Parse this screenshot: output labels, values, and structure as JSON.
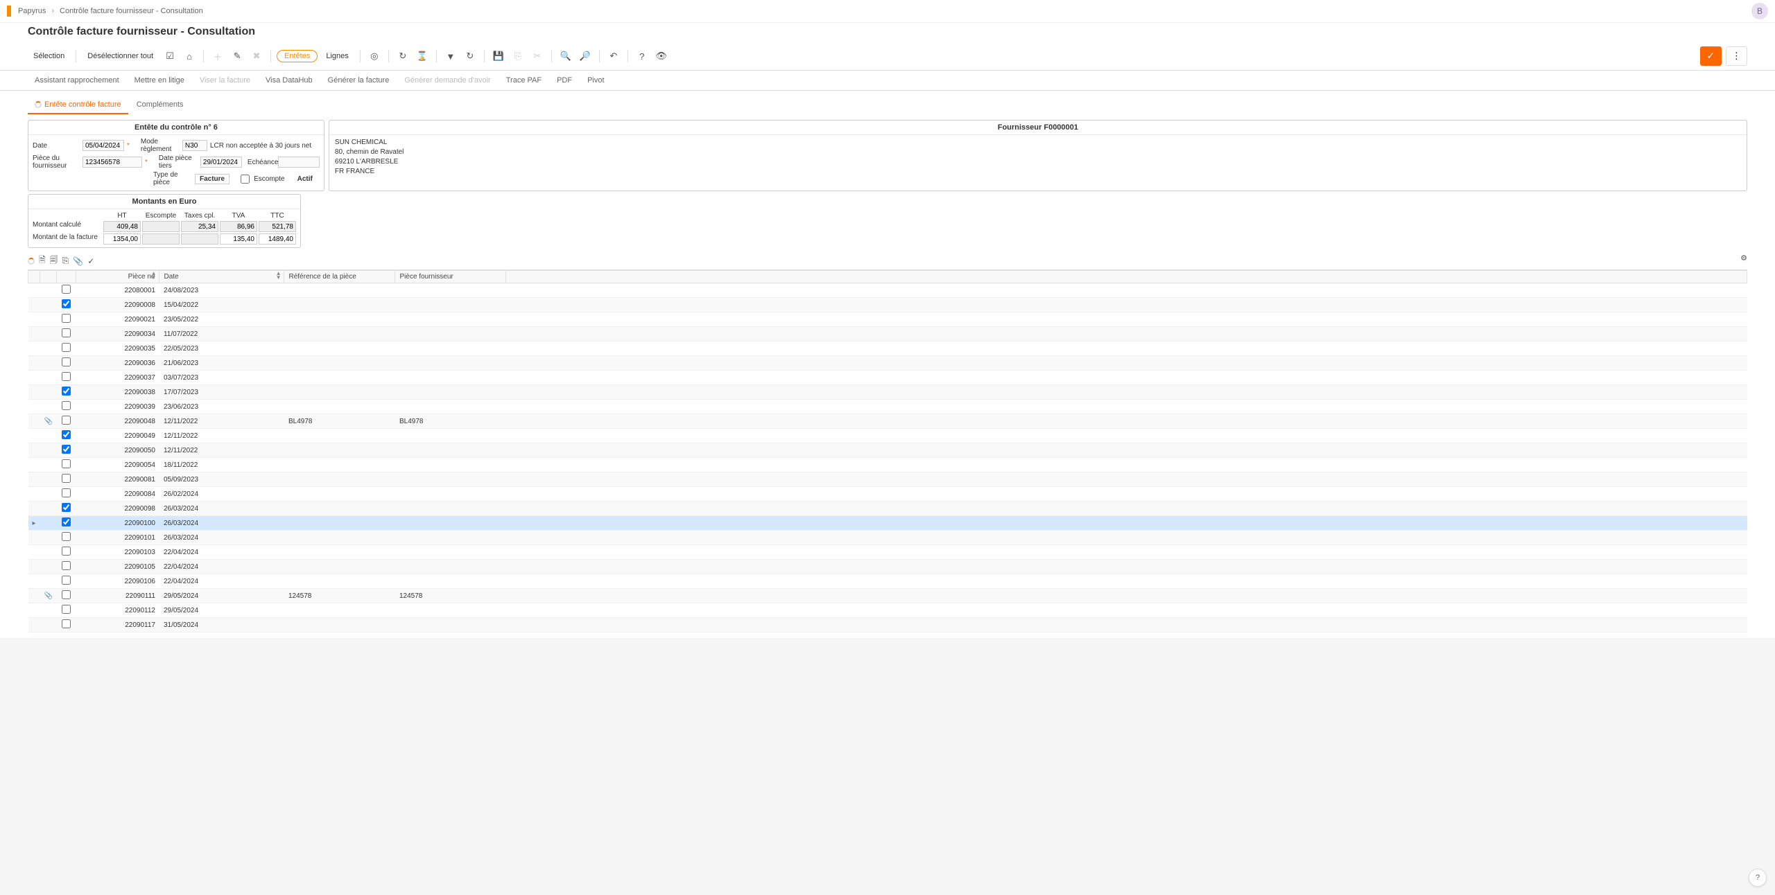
{
  "breadcrumb": {
    "root": "Papyrus",
    "current": "Contrôle facture fournisseur - Consultation"
  },
  "page_title": "Contrôle facture fournisseur - Consultation",
  "avatar_initial": "B",
  "toolbar": {
    "selection": "Sélection",
    "deselect_all": "Désélectionner tout",
    "entetes": "Entêtes",
    "lignes": "Lignes"
  },
  "subtabs": [
    {
      "label": "Assistant rapprochement",
      "id": "assistant",
      "disabled": false
    },
    {
      "label": "Mettre en litige",
      "id": "litige",
      "disabled": false
    },
    {
      "label": "Viser la facture",
      "id": "viser",
      "disabled": true
    },
    {
      "label": "Visa DataHub",
      "id": "visa",
      "disabled": false
    },
    {
      "label": "Générer la facture",
      "id": "gen-facture",
      "disabled": false
    },
    {
      "label": "Générer demande d'avoir",
      "id": "gen-avoir",
      "disabled": true
    },
    {
      "label": "Trace PAF",
      "id": "trace",
      "disabled": false
    },
    {
      "label": "PDF",
      "id": "pdf",
      "disabled": false
    },
    {
      "label": "Pivot",
      "id": "pivot",
      "disabled": false
    }
  ],
  "inner_tabs": {
    "entete": "Entête contrôle facture",
    "complements": "Compléments"
  },
  "panel_header": {
    "title": "Entête du contrôle n° 6",
    "labels": {
      "date": "Date",
      "piece_fournisseur": "Pièce du fournisseur",
      "mode_reglement": "Mode règlement",
      "date_piece_tiers": "Date pièce tiers",
      "type_piece": "Type de pièce",
      "echeance": "Echéance",
      "escompte": "Escompte",
      "actif": "Actif"
    },
    "values": {
      "date": "05/04/2024",
      "piece_fournisseur": "123456578",
      "mode_reglement": "N30",
      "mode_reglement_desc": "LCR non acceptée à 30 jours net",
      "date_piece_tiers": "29/01/2024",
      "echeance": "",
      "type_piece": "Facture"
    }
  },
  "supplier": {
    "title": "Fournisseur  F0000001",
    "name": "SUN CHEMICAL",
    "addr1": "80, chemin de Ravatel",
    "addr2": "69210  L'ARBRESLE",
    "country": "FR  FRANCE"
  },
  "amounts": {
    "title": "Montants en Euro",
    "headers": {
      "ht": "HT",
      "escompte": "Escompte",
      "taxes": "Taxes cpl.",
      "tva": "TVA",
      "ttc": "TTC"
    },
    "rows": {
      "calc_label": "Montant calculé",
      "fact_label": "Montant de la facture",
      "calc": {
        "ht": "409,48",
        "escompte": "",
        "taxes": "25,34",
        "tva": "86,96",
        "ttc": "521,78"
      },
      "fact": {
        "ht": "1354,00",
        "escompte": "",
        "taxes": "",
        "tva": "135,40",
        "ttc": "1489,40"
      }
    }
  },
  "grid_headers": {
    "piece_no": "Pièce no",
    "date": "Date",
    "ref_piece": "Référence de la pièce",
    "piece_fournisseur": "Pièce fournisseur"
  },
  "grid_rows": [
    {
      "checked": false,
      "att": false,
      "piece": "22080001",
      "date": "24/08/2023",
      "ref": "",
      "pf": "",
      "sel": false
    },
    {
      "checked": true,
      "att": false,
      "piece": "22090008",
      "date": "15/04/2022",
      "ref": "",
      "pf": "",
      "sel": false
    },
    {
      "checked": false,
      "att": false,
      "piece": "22090021",
      "date": "23/05/2022",
      "ref": "",
      "pf": "",
      "sel": false
    },
    {
      "checked": false,
      "att": false,
      "piece": "22090034",
      "date": "11/07/2022",
      "ref": "",
      "pf": "",
      "sel": false
    },
    {
      "checked": false,
      "att": false,
      "piece": "22090035",
      "date": "22/05/2023",
      "ref": "",
      "pf": "",
      "sel": false
    },
    {
      "checked": false,
      "att": false,
      "piece": "22090036",
      "date": "21/06/2023",
      "ref": "",
      "pf": "",
      "sel": false
    },
    {
      "checked": false,
      "att": false,
      "piece": "22090037",
      "date": "03/07/2023",
      "ref": "",
      "pf": "",
      "sel": false
    },
    {
      "checked": true,
      "att": false,
      "piece": "22090038",
      "date": "17/07/2023",
      "ref": "",
      "pf": "",
      "sel": false
    },
    {
      "checked": false,
      "att": false,
      "piece": "22090039",
      "date": "23/06/2023",
      "ref": "",
      "pf": "",
      "sel": false
    },
    {
      "checked": false,
      "att": true,
      "piece": "22090048",
      "date": "12/11/2022",
      "ref": "BL4978",
      "pf": "BL4978",
      "sel": false
    },
    {
      "checked": true,
      "att": false,
      "piece": "22090049",
      "date": "12/11/2022",
      "ref": "",
      "pf": "",
      "sel": false
    },
    {
      "checked": true,
      "att": false,
      "piece": "22090050",
      "date": "12/11/2022",
      "ref": "",
      "pf": "",
      "sel": false
    },
    {
      "checked": false,
      "att": false,
      "piece": "22090054",
      "date": "18/11/2022",
      "ref": "",
      "pf": "",
      "sel": false
    },
    {
      "checked": false,
      "att": false,
      "piece": "22090081",
      "date": "05/09/2023",
      "ref": "",
      "pf": "",
      "sel": false
    },
    {
      "checked": false,
      "att": false,
      "piece": "22090084",
      "date": "26/02/2024",
      "ref": "",
      "pf": "",
      "sel": false
    },
    {
      "checked": true,
      "att": false,
      "piece": "22090098",
      "date": "26/03/2024",
      "ref": "",
      "pf": "",
      "sel": false
    },
    {
      "checked": true,
      "att": false,
      "piece": "22090100",
      "date": "26/03/2024",
      "ref": "",
      "pf": "",
      "sel": true
    },
    {
      "checked": false,
      "att": false,
      "piece": "22090101",
      "date": "26/03/2024",
      "ref": "",
      "pf": "",
      "sel": false
    },
    {
      "checked": false,
      "att": false,
      "piece": "22090103",
      "date": "22/04/2024",
      "ref": "",
      "pf": "",
      "sel": false
    },
    {
      "checked": false,
      "att": false,
      "piece": "22090105",
      "date": "22/04/2024",
      "ref": "",
      "pf": "",
      "sel": false
    },
    {
      "checked": false,
      "att": false,
      "piece": "22090106",
      "date": "22/04/2024",
      "ref": "",
      "pf": "",
      "sel": false
    },
    {
      "checked": false,
      "att": true,
      "piece": "22090111",
      "date": "29/05/2024",
      "ref": "124578",
      "pf": "124578",
      "sel": false
    },
    {
      "checked": false,
      "att": false,
      "piece": "22090112",
      "date": "29/05/2024",
      "ref": "",
      "pf": "",
      "sel": false
    },
    {
      "checked": false,
      "att": false,
      "piece": "22090117",
      "date": "31/05/2024",
      "ref": "",
      "pf": "",
      "sel": false
    }
  ]
}
